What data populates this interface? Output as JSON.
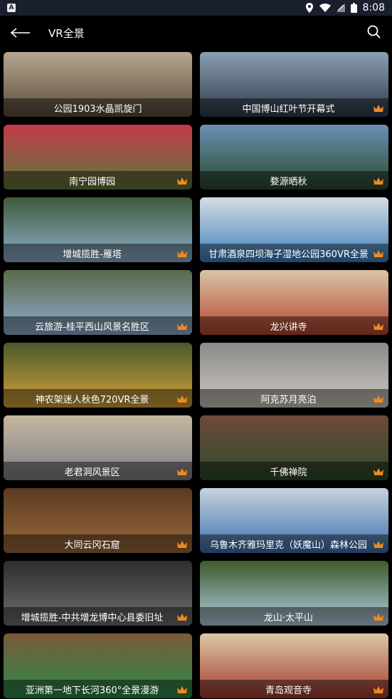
{
  "status_bar": {
    "app_icon_letter": "A",
    "time": "8:08"
  },
  "header": {
    "title": "VR全景",
    "back_icon": "back-arrow-icon",
    "search_icon": "search-icon"
  },
  "items": [
    {
      "label": "公园1903水晶凯旋门",
      "premium": false,
      "colors": [
        "#5a4a3a",
        "#b8a690"
      ]
    },
    {
      "label": "中国博山红叶节开幕式",
      "premium": true,
      "colors": [
        "#2e3a4a",
        "#8a9fb0"
      ]
    },
    {
      "label": "南宁园博园",
      "premium": true,
      "colors": [
        "#5b7a3a",
        "#c43a4a"
      ]
    },
    {
      "label": "婺源晒秋",
      "premium": true,
      "colors": [
        "#2b4a2a",
        "#6a8fb5"
      ]
    },
    {
      "label": "增城揽胜-雁塔",
      "premium": true,
      "colors": [
        "#8fb0cf",
        "#3f5b3a"
      ]
    },
    {
      "label": "甘肃酒泉四坝海子湿地公园360VR全景",
      "premium": true,
      "colors": [
        "#3a7fbf",
        "#d7dde2"
      ]
    },
    {
      "label": "云旅游-桂平西山风景名胜区",
      "premium": true,
      "colors": [
        "#8faed0",
        "#5a6a4a"
      ]
    },
    {
      "label": "龙兴讲寺",
      "premium": true,
      "colors": [
        "#b8442e",
        "#d7c6a8"
      ]
    },
    {
      "label": "神农架迷人秋色720VR全景",
      "premium": true,
      "colors": [
        "#d5a23a",
        "#4a5a2a"
      ]
    },
    {
      "label": "阿克苏月亮泊",
      "premium": true,
      "colors": [
        "#cfc9bf",
        "#8a8a8a"
      ]
    },
    {
      "label": "老君洞风景区",
      "premium": true,
      "colors": [
        "#7f7f85",
        "#c5b6a0"
      ]
    },
    {
      "label": "千佛禅院",
      "premium": true,
      "colors": [
        "#2d4a2a",
        "#6e4a3a"
      ]
    },
    {
      "label": "大同云冈石窟",
      "premium": true,
      "colors": [
        "#9a6a3a",
        "#5a3a22"
      ]
    },
    {
      "label": "乌鲁木齐雅玛里克（妖魔山）森林公园",
      "premium": true,
      "colors": [
        "#3a6fb0",
        "#c8d3dd"
      ]
    },
    {
      "label": "增城揽胜-中共增龙博中心县委旧址",
      "premium": true,
      "colors": [
        "#6f6f6f",
        "#2d2d2d"
      ]
    },
    {
      "label": "龙山·太平山",
      "premium": true,
      "colors": [
        "#b4cfe5",
        "#3d5a2a"
      ]
    },
    {
      "label": "亚洲第一地下长河360°全景漫游",
      "premium": true,
      "colors": [
        "#2a8a4a",
        "#7a5a3a"
      ]
    },
    {
      "label": "青岛观音寺",
      "premium": true,
      "colors": [
        "#a33a2e",
        "#dcc9a6"
      ]
    }
  ]
}
